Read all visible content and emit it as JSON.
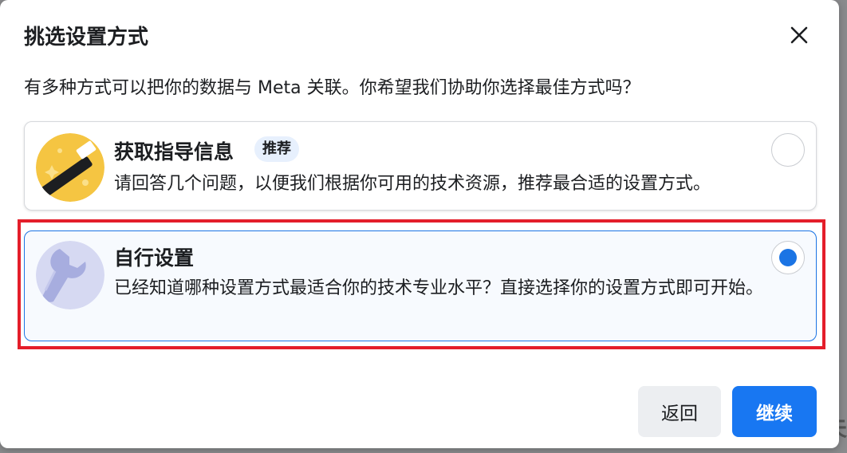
{
  "dialog": {
    "title": "挑选设置方式",
    "subtitle": "有多种方式可以把你的数据与 Meta 关联。你希望我们协助你选择最佳方式吗？",
    "close_icon": "close-icon"
  },
  "options": [
    {
      "title": "获取指导信息",
      "badge": "推荐",
      "description": "请回答几个问题，以便我们根据你可用的技术资源，推荐最合适的设置方式。",
      "icon": "magic-wand-icon",
      "selected": false
    },
    {
      "title": "自行设置",
      "description": "已经知道哪种设置方式最适合你的技术专业水平？直接选择你的设置方式即可开始。",
      "icon": "wrench-icon",
      "selected": true
    }
  ],
  "buttons": {
    "back": "返回",
    "continue": "继续"
  },
  "colors": {
    "primary": "#1877f2",
    "selected_border": "#1b74e4",
    "highlight": "#e41e2a",
    "wand_bg": "#f5c542",
    "wrench_bg": "#d6d9f2"
  }
}
